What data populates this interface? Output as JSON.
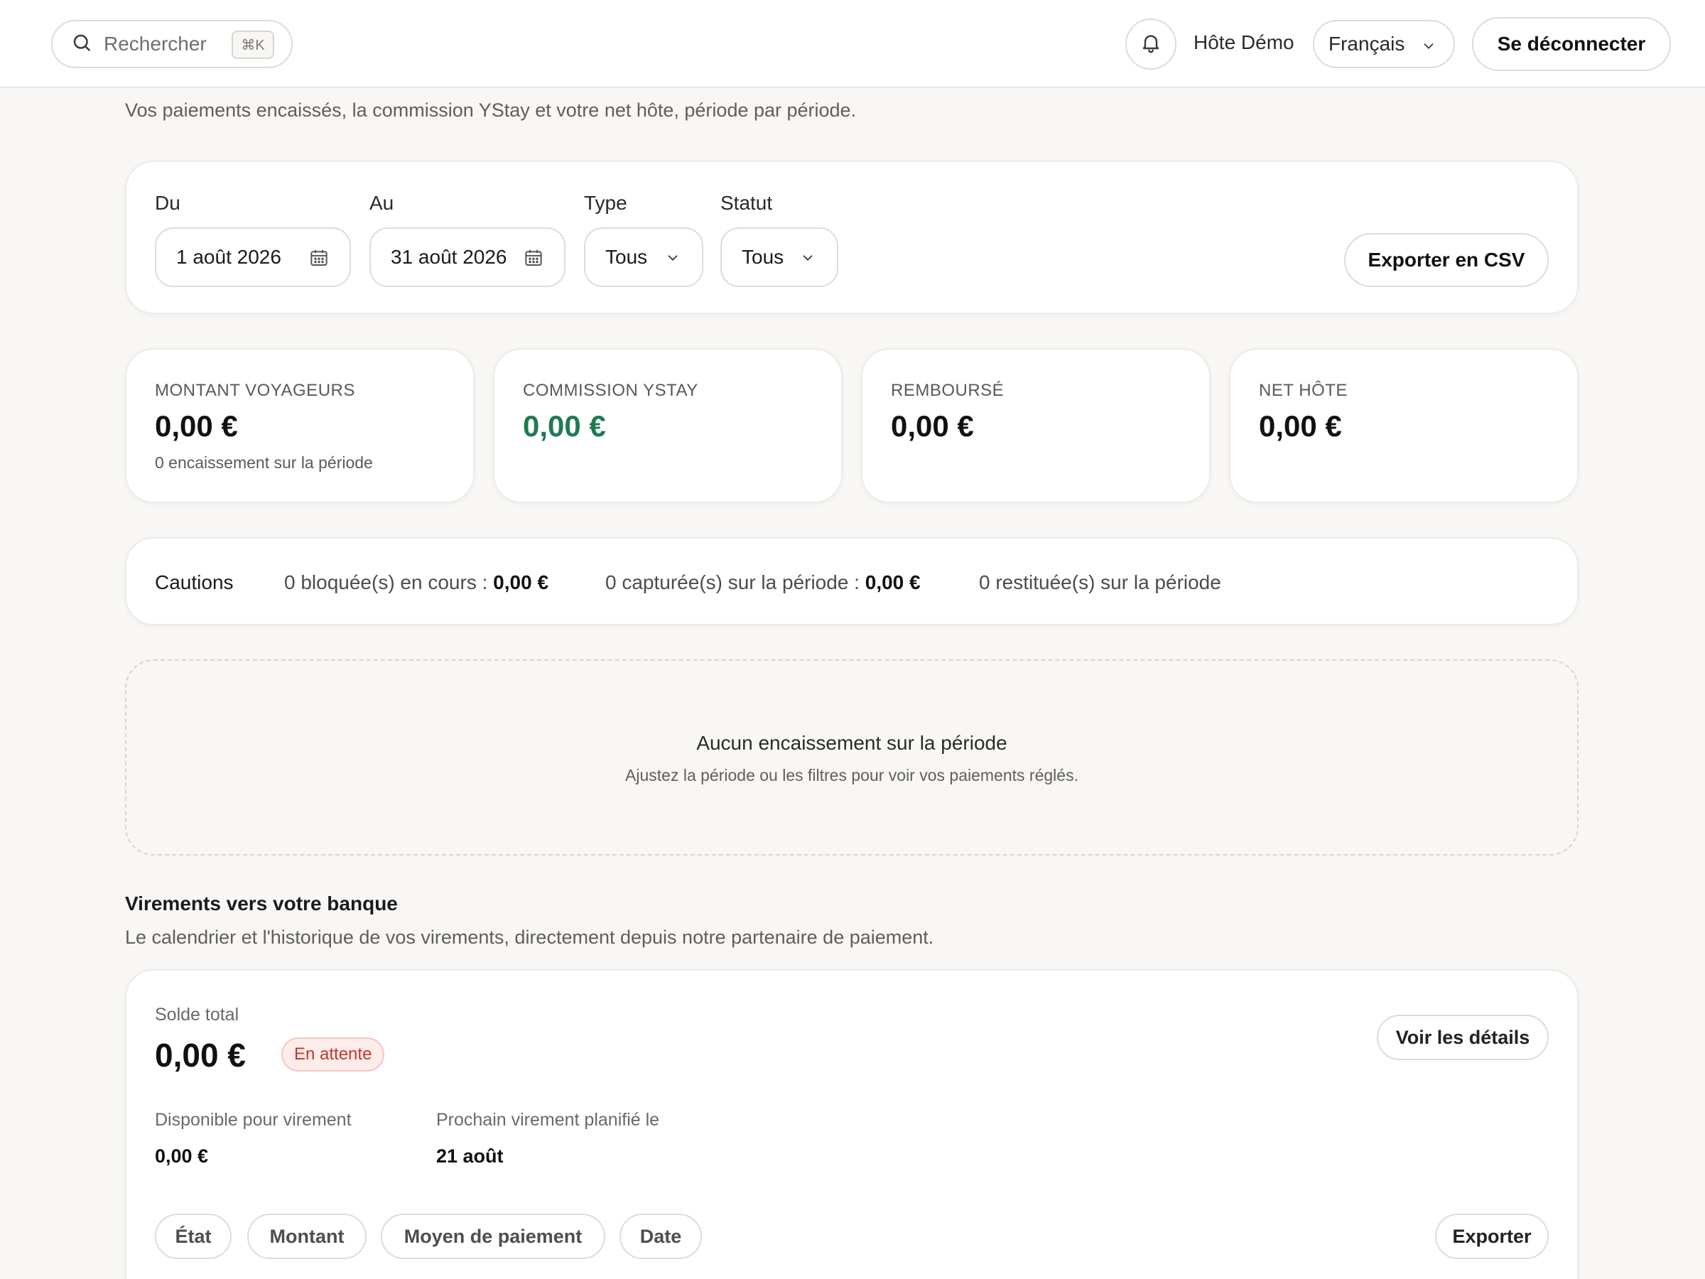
{
  "topbar": {
    "search_placeholder": "Rechercher",
    "search_shortcut": "⌘K",
    "user_name": "Hôte Démo",
    "language": "Français",
    "logout_label": "Se déconnecter"
  },
  "page": {
    "subtitle": "Vos paiements encaissés, la commission YStay et votre net hôte, période par période."
  },
  "filters": {
    "from_label": "Du",
    "from_value": "1 août 2026",
    "to_label": "Au",
    "to_value": "31 août 2026",
    "type_label": "Type",
    "type_value": "Tous",
    "status_label": "Statut",
    "status_value": "Tous",
    "export_label": "Exporter en CSV"
  },
  "stats": [
    {
      "label": "MONTANT VOYAGEURS",
      "value": "0,00 €",
      "note": "0 encaissement sur la période"
    },
    {
      "label": "COMMISSION YSTAY",
      "value": "0,00 €"
    },
    {
      "label": "REMBOURSÉ",
      "value": "0,00 €"
    },
    {
      "label": "NET HÔTE",
      "value": "0,00 €"
    }
  ],
  "cautions": {
    "title": "Cautions",
    "blocked_text": "0 bloquée(s) en cours : ",
    "blocked_amount": "0,00 €",
    "captured_text": "0 capturée(s) sur la période : ",
    "captured_amount": "0,00 €",
    "returned_text": "0 restituée(s) sur la période"
  },
  "empty_state": {
    "title": "Aucun encaissement sur la période",
    "subtitle": "Ajustez la période ou les filtres pour voir vos paiements réglés."
  },
  "payouts": {
    "title": "Virements vers votre banque",
    "subtitle": "Le calendrier et l'historique de vos virements, directement depuis notre partenaire de paiement.",
    "balance_label": "Solde total",
    "balance_value": "0,00 €",
    "status_badge": "En attente",
    "details_label": "Voir les détails",
    "available_label": "Disponible pour virement",
    "available_value": "0,00 €",
    "next_label": "Prochain virement planifié le",
    "next_value": "21 août",
    "columns": [
      "État",
      "Montant",
      "Moyen de paiement",
      "Date"
    ],
    "export_label": "Exporter"
  },
  "colors": {
    "accent_green": "#1f7a52",
    "badge_red": "#c0392b",
    "background": "#f8f7f5"
  }
}
